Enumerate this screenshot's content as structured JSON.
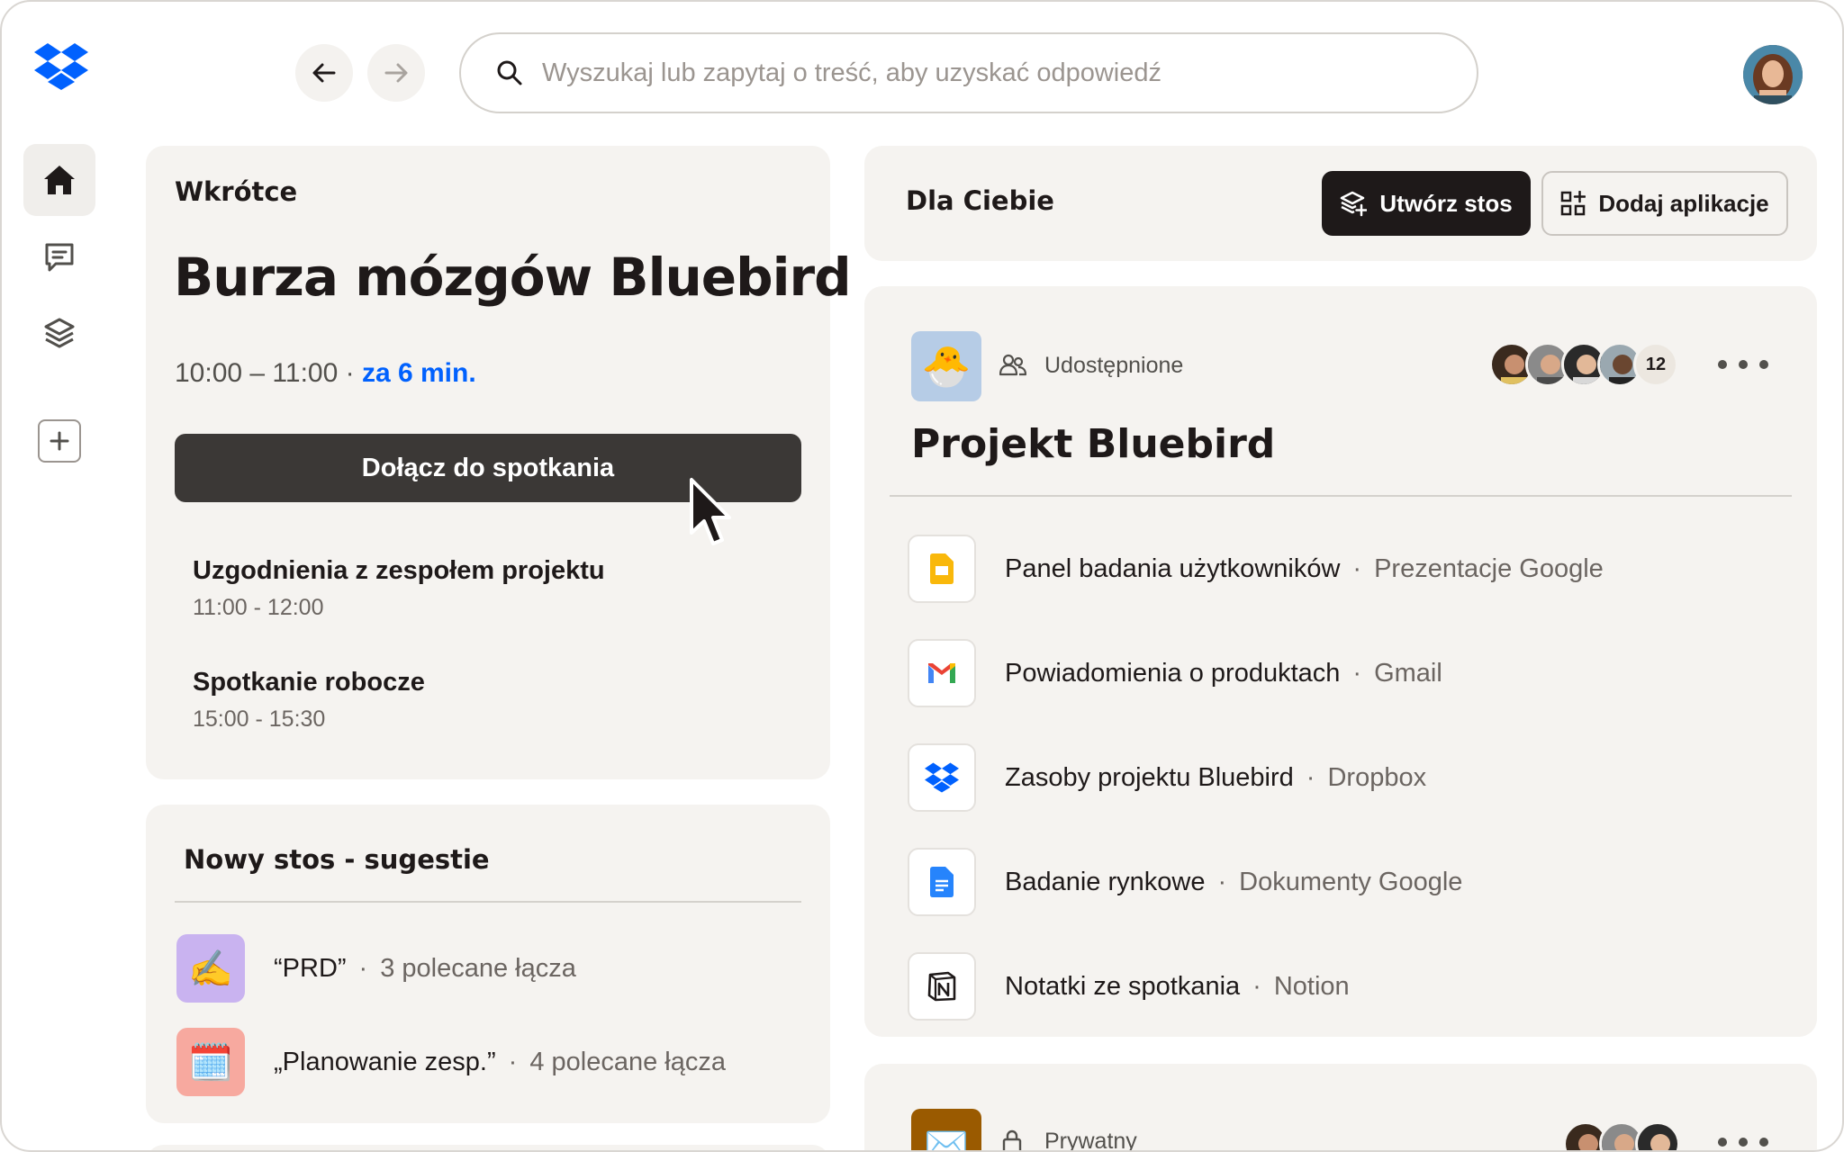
{
  "search": {
    "placeholder": "Wyszukaj lub zapytaj o treść, aby uzyskać odpowiedź"
  },
  "upcoming": {
    "label": "Wkrótce",
    "title": "Burza mózgów Bluebird",
    "time": "10:00 – 11:00 ·",
    "starts_in": "za 6 min.",
    "join_label": "Dołącz do spotkania",
    "events": [
      {
        "title": "Uzgodnienia z zespołem projektu",
        "time": "11:00 - 12:00"
      },
      {
        "title": "Spotkanie robocze",
        "time": "15:00 - 15:30"
      }
    ]
  },
  "suggestions": {
    "title": "Nowy stos - sugestie",
    "items": [
      {
        "emoji": "✍️",
        "name": "“PRD”",
        "meta": "3 polecane łącza",
        "color": "#c9b3f0"
      },
      {
        "emoji": "🗓️",
        "name": "„Planowanie zesp.”",
        "meta": "4 polecane łącza",
        "color": "#f7a99f"
      }
    ]
  },
  "for_you": {
    "label": "Dla Ciebie",
    "create_label": "Utwórz stos",
    "apps_label": "Dodaj aplikacje"
  },
  "project": {
    "emoji": "🐣",
    "shared_label": "Udostępnione",
    "member_count": "12",
    "title": "Projekt Bluebird",
    "files": [
      {
        "name": "Panel badania użytkowników",
        "source": "Prezentacje Google",
        "icon": "google-slides-icon"
      },
      {
        "name": "Powiadomienia o produktach",
        "source": "Gmail",
        "icon": "gmail-icon"
      },
      {
        "name": "Zasoby projektu Bluebird",
        "source": "Dropbox",
        "icon": "dropbox-icon"
      },
      {
        "name": "Badanie rynkowe",
        "source": "Dokumenty Google",
        "icon": "google-docs-icon"
      },
      {
        "name": "Notatki ze spotkania",
        "source": "Notion",
        "icon": "notion-icon"
      }
    ]
  },
  "private_stack": {
    "emoji": "✉️",
    "label": "Prywatny"
  },
  "colors": {
    "accent_blue": "#0061fe",
    "dark": "#1e1919",
    "card_bg": "#f5f3f0"
  }
}
